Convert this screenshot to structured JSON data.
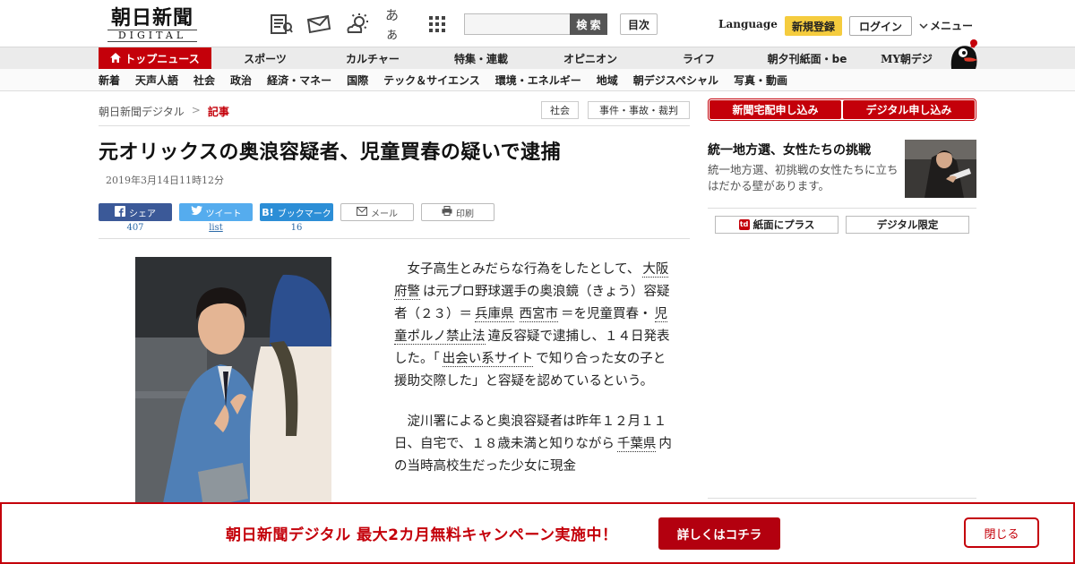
{
  "header": {
    "logo_main": "朝日新聞",
    "logo_sub": "DIGITAL",
    "icons": [
      "newspaper-icon",
      "mail-icon",
      "weather-icon",
      "font-size-icon",
      "grid-menu-icon"
    ],
    "font_size_label": "あぁ",
    "search_placeholder": "",
    "search_button": "検 索",
    "toc_button": "目次",
    "language": "Language",
    "register": "新規登録",
    "login": "ログイン",
    "menu": "メニュー"
  },
  "main_nav": [
    "トップニュース",
    "スポーツ",
    "カルチャー",
    "特集・連載",
    "オピニオン",
    "ライフ",
    "朝夕刊紙面・be",
    "MY朝デジ"
  ],
  "sub_nav": [
    "新着",
    "天声人語",
    "社会",
    "政治",
    "経済・マネー",
    "国際",
    "テック＆サイエンス",
    "環境・エネルギー",
    "地域",
    "朝デジスペシャル",
    "写真・動画"
  ],
  "breadcrumb": {
    "home": "朝日新聞デジタル",
    "separator": ">",
    "current": "記事"
  },
  "tags": [
    "社会",
    "事件・事故・裁判"
  ],
  "article": {
    "headline": "元オリックスの奥浪容疑者、児童買春の疑いで逮捕",
    "timestamp": "2019年3月14日11時12分",
    "share": {
      "facebook": "シェア",
      "facebook_count": "407",
      "twitter": "ツイート",
      "twitter_count": "list",
      "hatena": "ブックマーク",
      "hatena_count": "16",
      "mail": "メール",
      "print": "印刷"
    },
    "p1": {
      "t1": "女子高生とみだらな行為をしたとして、",
      "k1": "大阪府警",
      "t2": "は元プロ野球選手の奥浪鏡（きょう）容疑者（２３）＝",
      "k2": "兵庫県",
      "k3": "西宮市",
      "t3": "＝を児童買春・",
      "k4": "児童ポルノ禁止法",
      "t4": "違反容疑で逮捕し、１４日発表した。「",
      "k5": "出会い系サイト",
      "t5": "で知り合った女の子と援助交際した」と容疑を認めているという。"
    },
    "p2": {
      "t1": "淀川署によると奥浪容疑者は昨年１２月１１日、自宅で、１８歳未満と知りながら",
      "k1": "千葉県",
      "t2": "内の当時高校生だった少女に現金"
    }
  },
  "sidebar": {
    "buttons": [
      "新聞宅配申し込み",
      "デジタル申し込み"
    ],
    "feature_title": "統一地方選、女性たちの挑戦",
    "feature_desc": "統一地方選、初挑戦の女性たちに立ちはだかる壁があります。",
    "paper_plus_icon_label": "td",
    "paper_plus": "紙面にプラス",
    "digital_only": "デジタル限定"
  },
  "promo": {
    "text": "朝日新聞デジタル 最大2カ月無料キャンペーン実施中！",
    "cta": "詳しくはコチラ",
    "close": "閉じる"
  },
  "colors": {
    "brand_red": "#c4000a",
    "register_yellow": "#f5cc3e",
    "facebook": "#3b5998",
    "twitter": "#55acee",
    "hatena": "#2c8ed6"
  }
}
